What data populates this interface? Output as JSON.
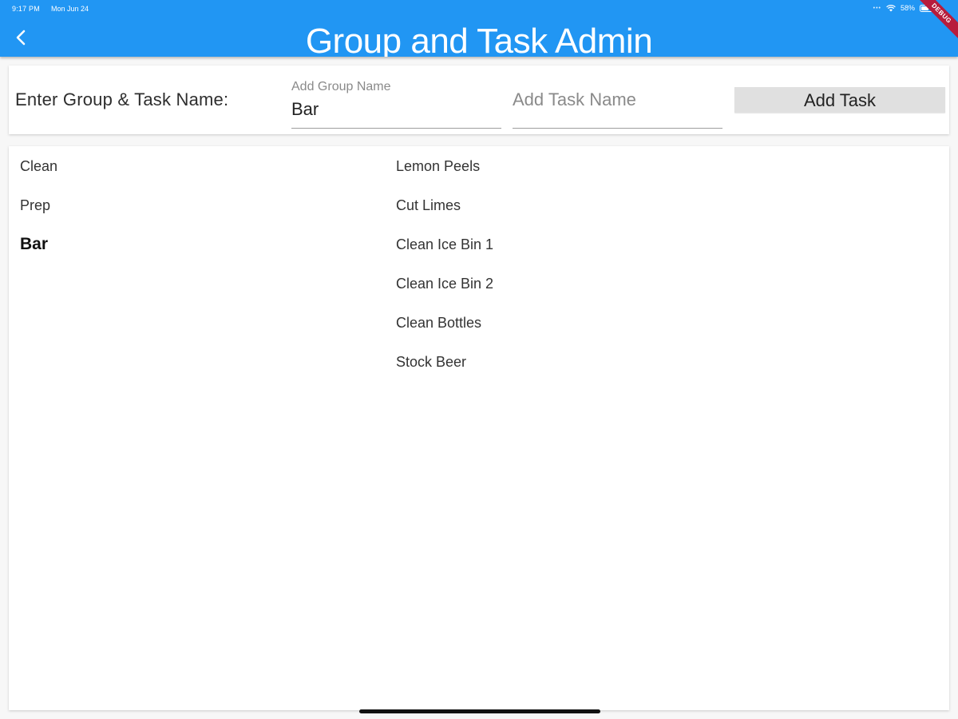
{
  "status_bar": {
    "time": "9:17 PM",
    "date": "Mon Jun 24",
    "dots": "•••",
    "battery": "58%",
    "debug_banner": "DEBUG"
  },
  "app_bar": {
    "title": "Group and Task Admin",
    "back_icon": "chevron-left-icon",
    "color": "#2196f3"
  },
  "form": {
    "label": "Enter Group & Task Name:",
    "group_field": {
      "label": "Add Group Name",
      "value": "Bar"
    },
    "task_field": {
      "placeholder": "Add Task Name",
      "value": ""
    },
    "add_button_label": "Add Task"
  },
  "groups": [
    {
      "label": "Clean",
      "selected": false
    },
    {
      "label": "Prep",
      "selected": false
    },
    {
      "label": "Bar",
      "selected": true
    }
  ],
  "tasks": [
    {
      "label": "Lemon Peels"
    },
    {
      "label": "Cut Limes"
    },
    {
      "label": "Clean Ice Bin 1"
    },
    {
      "label": "Clean Ice Bin 2"
    },
    {
      "label": "Clean Bottles"
    },
    {
      "label": "Stock Beer"
    }
  ]
}
